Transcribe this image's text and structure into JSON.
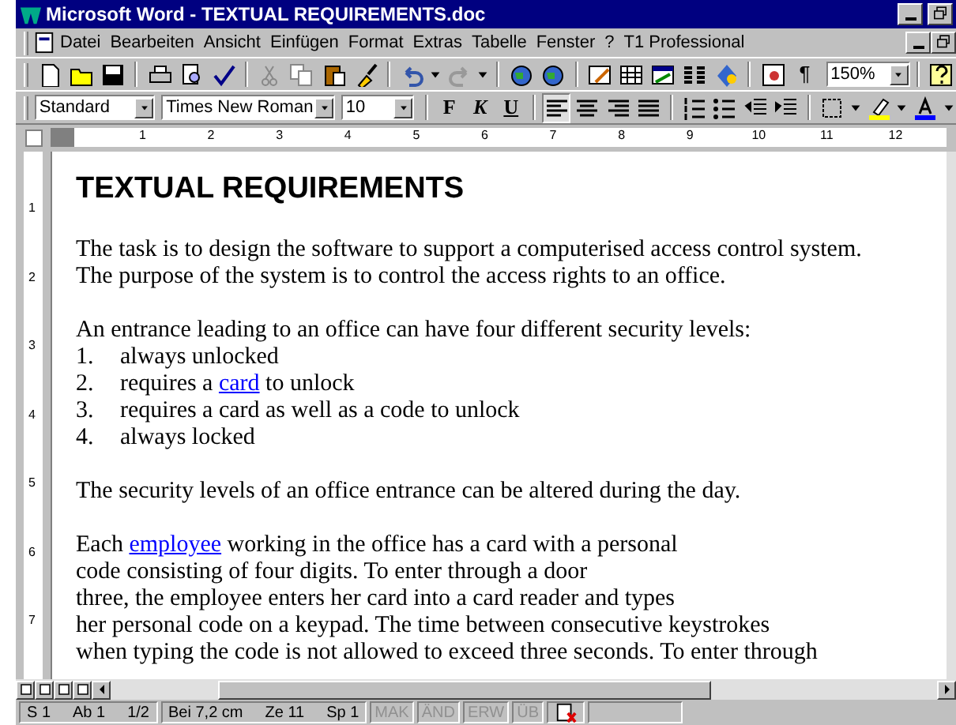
{
  "window": {
    "title": "Microsoft Word - TEXTUAL REQUIREMENTS.doc"
  },
  "menu": [
    "Datei",
    "Bearbeiten",
    "Ansicht",
    "Einfügen",
    "Format",
    "Extras",
    "Tabelle",
    "Fenster",
    "?",
    "T1 Professional"
  ],
  "toolbar": {
    "pilcrow": "¶",
    "zoom": "150%"
  },
  "formatting": {
    "style": "Standard",
    "font": "Times New Roman",
    "size": "10",
    "bold": "F",
    "italic": "K",
    "underline": "U"
  },
  "ruler": {
    "horizontal": [
      "1",
      "2",
      "3",
      "4",
      "5",
      "6",
      "7",
      "8",
      "9",
      "10",
      "11",
      "12"
    ],
    "vertical": [
      "1",
      "2",
      "3",
      "4",
      "5",
      "6",
      "7"
    ]
  },
  "document": {
    "heading": "TEXTUAL REQUIREMENTS",
    "blocks": [
      {
        "kind": "paragraph",
        "lines": [
          [
            {
              "text": "The task is to design the software to support a computerised access control system.",
              "link": false
            }
          ],
          [
            {
              "text": "The purpose of the system is to control the access rights to an office.",
              "link": false
            }
          ]
        ]
      },
      {
        "kind": "gap"
      },
      {
        "kind": "paragraph",
        "lines": [
          [
            {
              "text": "An entrance leading to an office can have four different security levels:",
              "link": false
            }
          ]
        ]
      },
      {
        "kind": "list",
        "items": [
          {
            "number": "1.",
            "parts": [
              {
                "text": "always unlocked",
                "link": false
              }
            ]
          },
          {
            "number": "2.",
            "parts": [
              {
                "text": "requires a ",
                "link": false
              },
              {
                "text": "card",
                "link": true
              },
              {
                "text": " to unlock",
                "link": false
              }
            ]
          },
          {
            "number": "3.",
            "parts": [
              {
                "text": "requires a card as well as a code to unlock",
                "link": false
              }
            ]
          },
          {
            "number": "4.",
            "parts": [
              {
                "text": "always locked",
                "link": false
              }
            ]
          }
        ]
      },
      {
        "kind": "gap"
      },
      {
        "kind": "paragraph",
        "lines": [
          [
            {
              "text": "The security levels of an office entrance can be altered during the day.",
              "link": false
            }
          ]
        ]
      },
      {
        "kind": "gap"
      },
      {
        "kind": "paragraph",
        "lines": [
          [
            {
              "text": "Each ",
              "link": false
            },
            {
              "text": "employee",
              "link": true
            },
            {
              "text": " working in the office has a card with a personal",
              "link": false
            }
          ],
          [
            {
              "text": "code consisting of four digits. To enter through a door",
              "link": false
            }
          ],
          [
            {
              "text": "three, the employee enters her card into a card reader and types",
              "link": false
            }
          ],
          [
            {
              "text": "her personal code on a keypad. The time between consecutive keystrokes",
              "link": false
            }
          ],
          [
            {
              "text": "when typing the code is not allowed to exceed three seconds. To enter through",
              "link": false
            }
          ]
        ]
      }
    ]
  },
  "status_bar": [
    {
      "text": "S 1",
      "disabled": false
    },
    {
      "text": "Ab 1",
      "disabled": false
    },
    {
      "text": "1/2",
      "disabled": false
    },
    {
      "text": "Bei 7,2 cm",
      "disabled": false
    },
    {
      "text": "Ze 11",
      "disabled": false
    },
    {
      "text": "Sp 1",
      "disabled": false
    },
    {
      "text": "MAK",
      "disabled": true
    },
    {
      "text": "ÄND",
      "disabled": true
    },
    {
      "text": "ERW",
      "disabled": true
    },
    {
      "text": "ÜB",
      "disabled": true
    }
  ]
}
